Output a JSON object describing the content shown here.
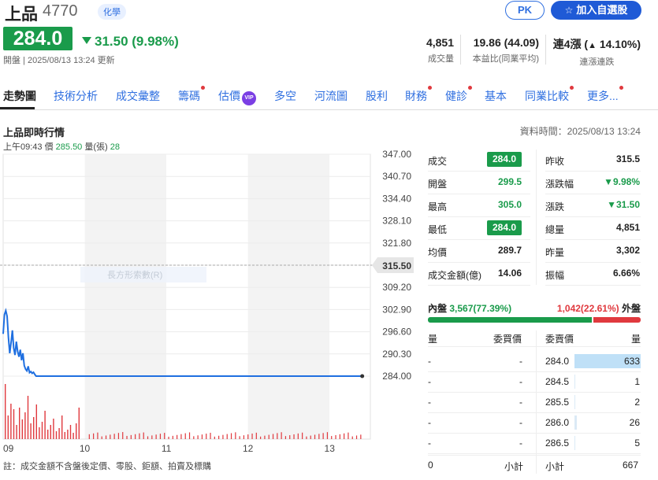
{
  "header": {
    "name": "上品",
    "code": "4770",
    "industry": "化學",
    "pk_label": "PK",
    "watch_label": "加入自選股",
    "price": "284.0",
    "change": "31.50 (9.98%)",
    "update_prefix": "開盤",
    "update_time": "2025/08/13 13:24 更新"
  },
  "stats": [
    {
      "value": "4,851",
      "label": "成交量"
    },
    {
      "value": "19.86 (44.09)",
      "label": "本益比(同業平均)"
    },
    {
      "value_prefix": "連4漲 (",
      "value_arrow": "▲",
      "value_rest": " 14.10%)",
      "label": "連漲連跌"
    }
  ],
  "tabs": [
    {
      "label": "走勢圖",
      "active": true,
      "dot": false
    },
    {
      "label": "技術分析",
      "active": false,
      "dot": false
    },
    {
      "label": "成交彙整",
      "active": false,
      "dot": false
    },
    {
      "label": "籌碼",
      "active": false,
      "dot": true
    },
    {
      "label": "估價",
      "active": false,
      "dot": false,
      "vip": "VIP"
    },
    {
      "label": "多空",
      "active": false,
      "dot": false
    },
    {
      "label": "河流圖",
      "active": false,
      "dot": false
    },
    {
      "label": "股利",
      "active": false,
      "dot": false
    },
    {
      "label": "財務",
      "active": false,
      "dot": true
    },
    {
      "label": "健診",
      "active": false,
      "dot": true
    },
    {
      "label": "基本",
      "active": false,
      "dot": false
    },
    {
      "label": "同業比較",
      "active": false,
      "dot": true
    },
    {
      "label": "更多...",
      "active": false,
      "dot": true
    }
  ],
  "section": {
    "title": "上品即時行情",
    "data_time": "資料時間：2025/08/13 13:24",
    "tick_time": "上午09:43",
    "tick_price_label": "價",
    "tick_price": "285.50",
    "tick_vol_label": "量(張)",
    "tick_vol": "28"
  },
  "chart_data": {
    "type": "line",
    "y_ticks": [
      "347.00",
      "340.70",
      "334.40",
      "328.10",
      "321.80",
      "315.50",
      "309.20",
      "302.90",
      "296.60",
      "290.30",
      "284.00"
    ],
    "x_ticks": [
      "09",
      "10",
      "11",
      "12",
      "13"
    ],
    "ylim": [
      284.0,
      347.0
    ],
    "reference_price": "315.50",
    "hover_label": "長方形索數(R)",
    "series": [
      {
        "values": [
          296.0,
          301.5,
          302.6,
          301.0,
          295.0,
          290.5,
          293.5,
          297.0,
          292.0,
          290.0,
          293.8,
          291.0,
          289.5,
          291.5,
          288.5,
          290.5,
          287.0,
          286.0,
          285.5,
          286.8,
          285.0,
          285.3,
          284.8,
          285.1,
          284.5,
          284.0,
          284.0
        ]
      }
    ],
    "line_color": "#1f6fe0",
    "volume_color": "#e0393e"
  },
  "quote": {
    "left": [
      {
        "label": "成交",
        "value": "284.0",
        "style": "box"
      },
      {
        "label": "開盤",
        "value": "299.5",
        "style": "green"
      },
      {
        "label": "最高",
        "value": "305.0",
        "style": "green"
      },
      {
        "label": "最低",
        "value": "284.0",
        "style": "box"
      },
      {
        "label": "均價",
        "value": "289.7",
        "style": "plain"
      },
      {
        "label": "成交金額(億)",
        "value": "14.06",
        "style": "plain"
      }
    ],
    "right": [
      {
        "label": "昨收",
        "value": "315.5",
        "style": "plain"
      },
      {
        "label": "漲跌幅",
        "value": "▼9.98%",
        "style": "green"
      },
      {
        "label": "漲跌",
        "value": "▼31.50",
        "style": "green"
      },
      {
        "label": "總量",
        "value": "4,851",
        "style": "plain"
      },
      {
        "label": "昨量",
        "value": "3,302",
        "style": "plain"
      },
      {
        "label": "振幅",
        "value": "6.66%",
        "style": "plain"
      }
    ]
  },
  "inout": {
    "in_label": "內盤",
    "in_value": "3,567(77.39%)",
    "in_ratio": 0.7739,
    "out_value": "1,042(22.61%)",
    "out_label": "外盤"
  },
  "orderbook": {
    "headers": {
      "bid_vol": "量",
      "bid_price": "委買價",
      "ask_price": "委賣價",
      "ask_vol": "量"
    },
    "rows": [
      {
        "bid_vol": "-",
        "bid_price": "-",
        "ask_price": "284.0",
        "ask_vol": "633",
        "ask_ratio": 1.0
      },
      {
        "bid_vol": "-",
        "bid_price": "-",
        "ask_price": "284.5",
        "ask_vol": "1",
        "ask_ratio": 0.002
      },
      {
        "bid_vol": "-",
        "bid_price": "-",
        "ask_price": "285.5",
        "ask_vol": "2",
        "ask_ratio": 0.003
      },
      {
        "bid_vol": "-",
        "bid_price": "-",
        "ask_price": "286.0",
        "ask_vol": "26",
        "ask_ratio": 0.04
      },
      {
        "bid_vol": "-",
        "bid_price": "-",
        "ask_price": "286.5",
        "ask_vol": "5",
        "ask_ratio": 0.008
      }
    ],
    "subtotal_label": "小計",
    "bid_total": "0",
    "ask_total": "667"
  },
  "footnote": "註：成交金額不含盤後定價、零股、鉅額、拍賣及標購"
}
